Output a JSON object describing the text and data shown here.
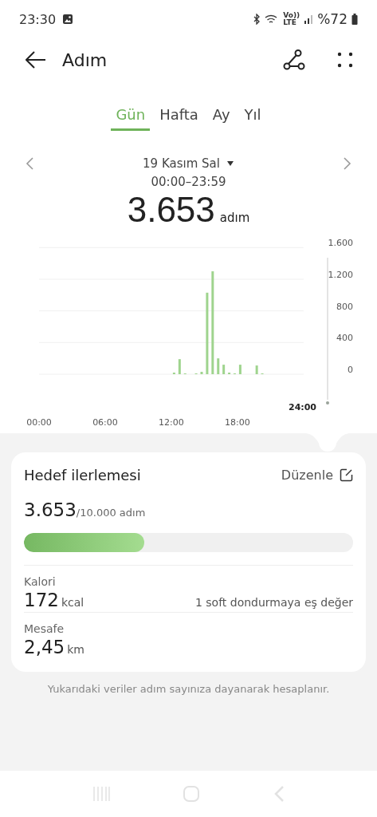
{
  "status_bar": {
    "time": "23:30",
    "volte": [
      "Vo))",
      "LTE"
    ],
    "battery": "%72"
  },
  "header": {
    "title": "Adım"
  },
  "tabs": [
    {
      "label": "Gün",
      "selected": true
    },
    {
      "label": "Hafta",
      "selected": false
    },
    {
      "label": "Ay",
      "selected": false
    },
    {
      "label": "Yıl",
      "selected": false
    }
  ],
  "date_nav": {
    "date": "19 Kasım Sal",
    "range": "00:00–23:59",
    "total": "3.653",
    "unit": "adım"
  },
  "chart": {
    "cursor_label": "24:00",
    "chart_data": {
      "type": "bar",
      "grid": true,
      "x": [
        12.25,
        12.75,
        13.25,
        14.25,
        14.75,
        15.25,
        15.75,
        16.25,
        16.75,
        17.25,
        17.75,
        18.25,
        19.75,
        20.25
      ],
      "series": [
        {
          "color": "#9fd48e",
          "values": [
            20,
            190,
            10,
            10,
            30,
            1030,
            1300,
            200,
            120,
            20,
            10,
            120,
            110,
            10
          ]
        }
      ],
      "xlim": [
        0,
        24
      ],
      "ylim": [
        0,
        1600
      ],
      "xticks": [
        {
          "value": 0,
          "label": "00:00"
        },
        {
          "value": 6,
          "label": "06:00"
        },
        {
          "value": 12,
          "label": "12:00"
        },
        {
          "value": 18,
          "label": "18:00"
        }
      ],
      "yticks": [
        {
          "value": 0,
          "label": "0"
        },
        {
          "value": 400,
          "label": "400"
        },
        {
          "value": 800,
          "label": "800"
        },
        {
          "value": 1200,
          "label": "1.200"
        },
        {
          "value": 1600,
          "label": "1.600"
        }
      ]
    }
  },
  "goal_card": {
    "title": "Hedef ilerlemesi",
    "edit": "Düzenle",
    "current": "3.653",
    "target": "/10.000 adım",
    "level": 0.3653,
    "stats": [
      {
        "label": "Kalori",
        "value": "172",
        "unit": "kcal",
        "note": "1 soft dondurmaya eş değer"
      },
      {
        "label": "Mesafe",
        "value": "2,45",
        "unit": "km"
      }
    ]
  },
  "footnote": "Yukarıdaki veriler adım sayınıza dayanarak hesaplanır."
}
